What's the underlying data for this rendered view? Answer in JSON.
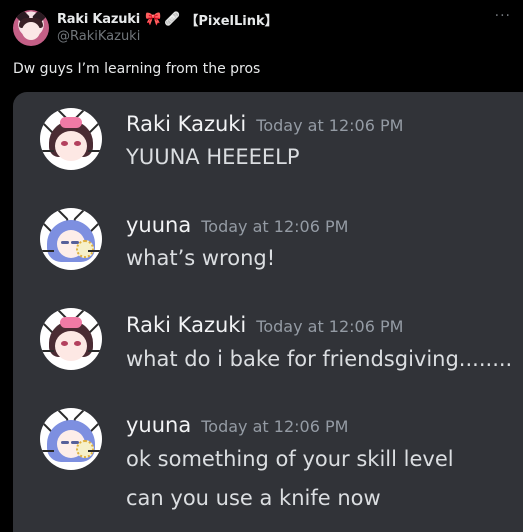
{
  "tweet": {
    "display_name": "Raki Kazuki",
    "name_emojis": [
      "🎀",
      "🩹"
    ],
    "name_tag": "【PixelLink】",
    "handle": "@RakiKazuki",
    "more_icon": "ellipsis-icon",
    "text": "Dw guys I’m learning from the pros"
  },
  "discord": {
    "messages": [
      {
        "author": "Raki Kazuki",
        "timestamp": "Today at 12:06 PM",
        "lines": [
          "YUUNA HEEEELP"
        ]
      },
      {
        "author": "yuuna",
        "timestamp": "Today at 12:06 PM",
        "lines": [
          "what’s wrong!"
        ]
      },
      {
        "author": "Raki Kazuki",
        "timestamp": "Today at 12:06 PM",
        "lines": [
          "what do i bake for friendsgiving........"
        ]
      },
      {
        "author": "yuuna",
        "timestamp": "Today at 12:06 PM",
        "lines": [
          "ok something of your skill level",
          "can you use a knife now"
        ]
      }
    ]
  },
  "colors": {
    "page_bg": "#000000",
    "discord_bg": "#313338",
    "text_primary": "#e7e9ea",
    "text_muted": "#71767b",
    "discord_timestamp": "#949ba4"
  }
}
